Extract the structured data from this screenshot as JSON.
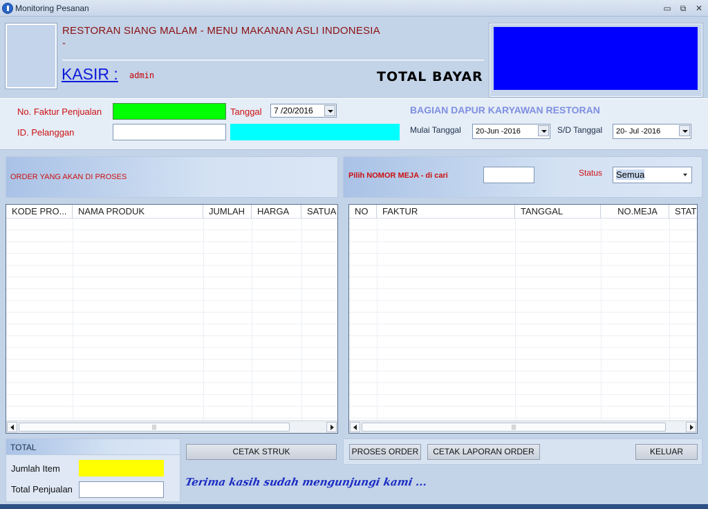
{
  "window": {
    "title": "Monitoring Pesanan",
    "minimize_glyph": "▭",
    "restore_glyph": "⧉",
    "close_glyph": "✕"
  },
  "header": {
    "restaurant_title": "RESTORAN SIANG MALAM - MENU MAKANAN ASLI INDONESIA",
    "title_dash": "-",
    "kasir_label": "KASIR :",
    "kasir_value": "admin",
    "total_bayar_label": "TOTAL BAYAR",
    "total_bayar_color": "#0000ff"
  },
  "form": {
    "faktur_label": "No. Faktur Penjualan",
    "faktur_value": "",
    "faktur_color": "#00ff00",
    "tanggal_label": "Tanggal",
    "tanggal_value": "7 /20/2016",
    "pelanggan_label": "ID. Pelanggan",
    "pelanggan_value": "",
    "pelanggan_name_color": "#00ffff"
  },
  "kitchen": {
    "title": "BAGIAN DAPUR KARYAWAN RESTORAN",
    "mulai_label": "Mulai Tanggal",
    "mulai_value": "20-Jun -2016",
    "sd_label": "S/D Tanggal",
    "sd_value": "20- Jul -2016"
  },
  "order_panel": {
    "title": "ORDER YANG AKAN DI PROSES",
    "columns": [
      "KODE PRO...",
      "NAMA PRODUK",
      "JUMLAH",
      "HARGA",
      "SATUA"
    ]
  },
  "meja_panel": {
    "search_label": "Pilih NOMOR MEJA - di cari",
    "search_value": "",
    "status_label": "Status",
    "status_value": "Semua",
    "columns": [
      "NO",
      "FAKTUR",
      "TANGGAL",
      "NO.MEJA",
      "STAT"
    ]
  },
  "total_panel": {
    "title": "TOTAL",
    "jumlah_item_label": "Jumlah Item",
    "jumlah_item_value": "",
    "jumlah_item_color": "#ffff00",
    "total_penjualan_label": "Total Penjualan",
    "total_penjualan_value": ""
  },
  "buttons": {
    "cetak_struk": "CETAK STRUK",
    "proses_order": "PROSES ORDER",
    "cetak_laporan": "CETAK LAPORAN ORDER",
    "keluar": "KELUAR"
  },
  "footer": {
    "thanks": "Terima kasih sudah mengunjungi kami ..."
  },
  "scrollbar": {
    "thumb_grip": "|||"
  }
}
